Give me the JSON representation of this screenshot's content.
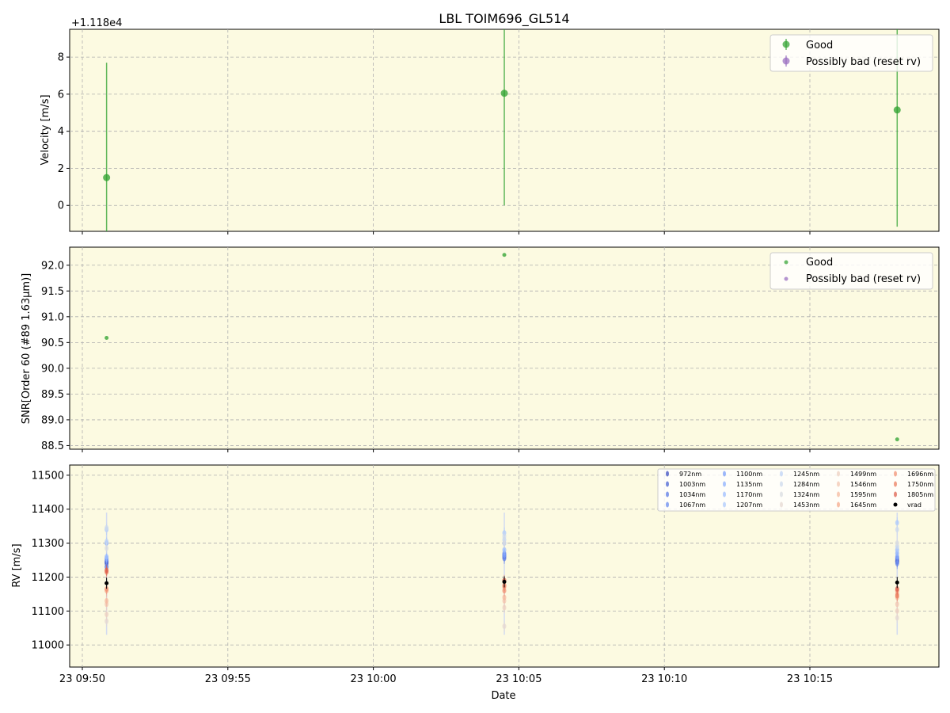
{
  "figure_title": "LBL TOIM696_GL514",
  "chart_data": [
    {
      "type": "scatter",
      "panel": "velocity",
      "ylabel": "Velocity [m/s]",
      "offset_label": "+1.118e4",
      "ylim": [
        -1.4,
        9.5
      ],
      "yticks": [
        0,
        2,
        4,
        6,
        8
      ],
      "grid": true,
      "legend": "top-right",
      "series": [
        {
          "name": "Good",
          "color": "#2ca02c",
          "x": [
            "09:50:50",
            "10:04:30",
            "10:18:00"
          ],
          "y": [
            1.5,
            6.05,
            5.15
          ],
          "err": [
            6.2,
            6.05,
            6.3
          ]
        },
        {
          "name": "Possibly bad (reset rv)",
          "color": "#9467bd",
          "x": [],
          "y": [],
          "err": []
        }
      ]
    },
    {
      "type": "scatter",
      "panel": "snr",
      "ylabel": "SNR[Order 60 (#89 1.63μm)]",
      "ylim": [
        88.43,
        92.35
      ],
      "yticks": [
        88.5,
        89.0,
        89.5,
        90.0,
        90.5,
        91.0,
        91.5,
        92.0
      ],
      "grid": true,
      "legend": "top-right",
      "series": [
        {
          "name": "Good",
          "color": "#2ca02c",
          "x": [
            "09:50:50",
            "10:04:30",
            "10:18:00"
          ],
          "y": [
            90.59,
            92.2,
            88.62
          ]
        },
        {
          "name": "Possibly bad (reset rv)",
          "color": "#9467bd",
          "x": [],
          "y": []
        }
      ]
    },
    {
      "type": "scatter",
      "panel": "rv",
      "ylabel": "RV [m/s]",
      "xlabel": "Date",
      "ylim": [
        10935,
        11530
      ],
      "yticks": [
        11000,
        11100,
        11200,
        11300,
        11400,
        11500
      ],
      "grid": true,
      "legend": "top-right",
      "x": [
        "09:50:50",
        "10:04:30",
        "10:18:00"
      ],
      "series": [
        {
          "name": "972nm",
          "color": "#3b4cc0",
          "values": [
            11245,
            11265,
            11245
          ]
        },
        {
          "name": "1003nm",
          "color": "#4a63d3",
          "values": [
            11240,
            11260,
            11250
          ]
        },
        {
          "name": "1034nm",
          "color": "#5b7ae5",
          "values": [
            11230,
            11255,
            11255
          ]
        },
        {
          "name": "1067nm",
          "color": "#6a8bef",
          "values": [
            11250,
            11270,
            11240
          ]
        },
        {
          "name": "1100nm",
          "color": "#7b9ff9",
          "values": [
            11255,
            11265,
            11260
          ]
        },
        {
          "name": "1135nm",
          "color": "#8db0fe",
          "values": [
            11300,
            11300,
            11270
          ]
        },
        {
          "name": "1170nm",
          "color": "#9ebeff",
          "values": [
            11260,
            11280,
            11280
          ]
        },
        {
          "name": "1207nm",
          "color": "#aec9fc",
          "values": [
            11340,
            11330,
            11360
          ]
        },
        {
          "name": "1245nm",
          "color": "#bfd3f6",
          "values": [
            11305,
            11310,
            11290
          ]
        },
        {
          "name": "1284nm",
          "color": "#cdd9ec",
          "values": [
            11345,
            11320,
            11340
          ]
        },
        {
          "name": "1324nm",
          "color": "#dadce0",
          "values": [
            11285,
            11300,
            11300
          ]
        },
        {
          "name": "1453nm",
          "color": "#e5d8d1",
          "values": [
            11070,
            11055,
            11080
          ]
        },
        {
          "name": "1499nm",
          "color": "#eed0c0",
          "values": [
            11090,
            11110,
            11100
          ]
        },
        {
          "name": "1546nm",
          "color": "#f3c7b1",
          "values": [
            11120,
            11130,
            11120
          ]
        },
        {
          "name": "1595nm",
          "color": "#f5b99f",
          "values": [
            11130,
            11140,
            11140
          ]
        },
        {
          "name": "1645nm",
          "color": "#f5a98b",
          "values": [
            11160,
            11170,
            11150
          ]
        },
        {
          "name": "1696nm",
          "color": "#f29274",
          "values": [
            11165,
            11160,
            11160
          ]
        },
        {
          "name": "1750nm",
          "color": "#eb7d5f",
          "values": [
            11215,
            11175,
            11145
          ]
        },
        {
          "name": "1805nm",
          "color": "#de604d",
          "values": [
            11220,
            11190,
            11165
          ]
        },
        {
          "name": "vrad",
          "color": "#000000",
          "values": [
            11182,
            11186,
            11184
          ]
        }
      ]
    }
  ],
  "x_axis": {
    "label": "Date",
    "ticks": [
      "23 09:50",
      "23 09:55",
      "23 10:00",
      "23 10:05",
      "23 10:10",
      "23 10:15"
    ]
  }
}
